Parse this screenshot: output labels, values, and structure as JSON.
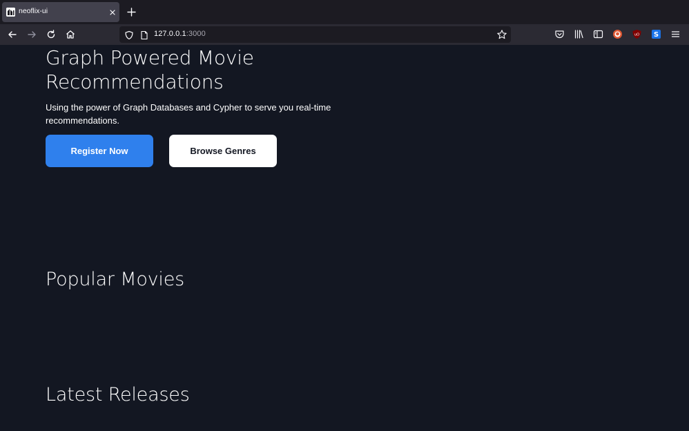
{
  "browser": {
    "tab_title": "neoflix-ui",
    "url_host": "127.0.0.1",
    "url_port": ":3000",
    "icons": {
      "favicon": "favicon-icon",
      "close": "close-icon",
      "new_tab": "plus-icon",
      "back": "back-arrow-icon",
      "forward": "forward-arrow-icon",
      "reload": "reload-icon",
      "home": "home-icon",
      "shield": "shield-icon",
      "page": "page-icon",
      "bookmark": "star-icon",
      "pocket": "pocket-icon",
      "library": "library-icon",
      "sidebar": "sidebar-icon",
      "duckduckgo": "duckduckgo-icon",
      "ublock": "ublock-icon",
      "extension_s": "extension-s-icon",
      "menu": "hamburger-menu-icon"
    }
  },
  "hero": {
    "title": "Graph Powered Movie Recommendations",
    "subtitle": "Using the power of Graph Databases and Cypher to serve you real-time recommendations.",
    "primary_button": "Register Now",
    "secondary_button": "Browse Genres"
  },
  "sections": {
    "popular": "Popular Movies",
    "latest": "Latest Releases"
  },
  "colors": {
    "page_bg": "#131722",
    "primary": "#2f80ed",
    "text": "#ffffff"
  }
}
